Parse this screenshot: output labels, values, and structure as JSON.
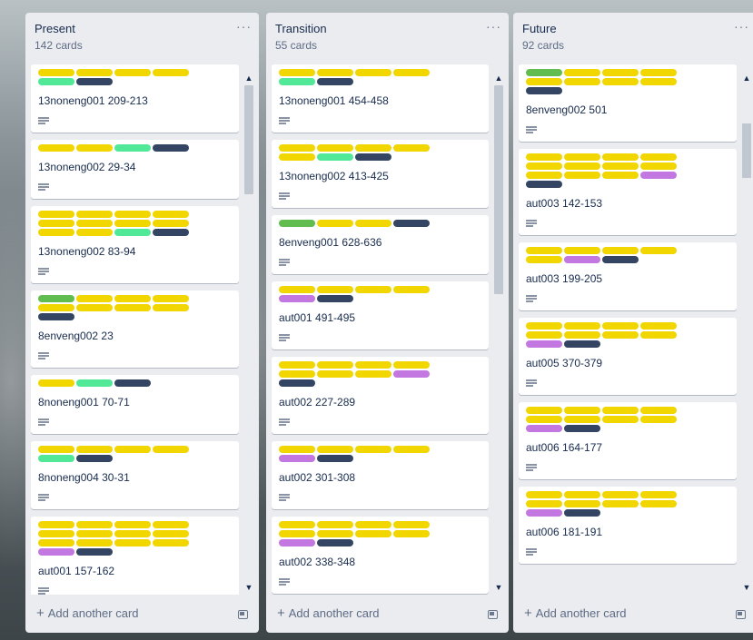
{
  "lists": [
    {
      "title": "Present",
      "count": "142 cards",
      "add_label": "Add another card",
      "cards": [
        {
          "labels": [
            "yellow",
            "yellow",
            "yellow",
            "yellow",
            "teal",
            "navy"
          ],
          "title": "13noneng001 209-213"
        },
        {
          "labels": [
            "yellow",
            "yellow",
            "teal",
            "navy"
          ],
          "title": "13noneng002 29-34"
        },
        {
          "labels": [
            "yellow",
            "yellow",
            "yellow",
            "yellow",
            "yellow",
            "yellow",
            "yellow",
            "yellow",
            "yellow",
            "yellow",
            "teal",
            "navy"
          ],
          "title": "13noneng002 83-94"
        },
        {
          "labels": [
            "green",
            "yellow",
            "yellow",
            "yellow",
            "yellow",
            "yellow",
            "yellow",
            "yellow",
            "navy"
          ],
          "title": "8enveng002 23"
        },
        {
          "labels": [
            "yellow",
            "teal",
            "navy"
          ],
          "title": "8noneng001 70-71"
        },
        {
          "labels": [
            "yellow",
            "yellow",
            "yellow",
            "yellow",
            "teal",
            "navy"
          ],
          "title": "8noneng004 30-31"
        },
        {
          "labels": [
            "yellow",
            "yellow",
            "yellow",
            "yellow",
            "yellow",
            "yellow",
            "yellow",
            "yellow",
            "yellow",
            "yellow",
            "yellow",
            "yellow",
            "purple",
            "navy"
          ],
          "title": "aut001 157-162"
        }
      ]
    },
    {
      "title": "Transition",
      "count": "55 cards",
      "add_label": "Add another card",
      "cards": [
        {
          "labels": [
            "yellow",
            "yellow",
            "yellow",
            "yellow",
            "teal",
            "navy"
          ],
          "title": "13noneng001 454-458"
        },
        {
          "labels": [
            "yellow",
            "yellow",
            "yellow",
            "yellow",
            "yellow",
            "teal",
            "navy"
          ],
          "title": "13noneng002 413-425"
        },
        {
          "labels": [
            "green",
            "yellow",
            "yellow",
            "navy"
          ],
          "title": "8enveng001 628-636"
        },
        {
          "labels": [
            "yellow",
            "yellow",
            "yellow",
            "yellow",
            "purple",
            "navy"
          ],
          "title": "aut001 491-495"
        },
        {
          "labels": [
            "yellow",
            "yellow",
            "yellow",
            "yellow",
            "yellow",
            "yellow",
            "yellow",
            "purple",
            "navy"
          ],
          "title": "aut002 227-289"
        },
        {
          "labels": [
            "yellow",
            "yellow",
            "yellow",
            "yellow",
            "purple",
            "navy"
          ],
          "title": "aut002 301-308"
        },
        {
          "labels": [
            "yellow",
            "yellow",
            "yellow",
            "yellow",
            "yellow",
            "yellow",
            "yellow",
            "yellow",
            "purple",
            "navy"
          ],
          "title": "aut002 338-348"
        }
      ]
    },
    {
      "title": "Future",
      "count": "92 cards",
      "add_label": "Add another card",
      "cards": [
        {
          "labels": [
            "green",
            "yellow",
            "yellow",
            "yellow",
            "yellow",
            "yellow",
            "yellow",
            "yellow",
            "navy"
          ],
          "title": "8enveng002 501"
        },
        {
          "labels": [
            "yellow",
            "yellow",
            "yellow",
            "yellow",
            "yellow",
            "yellow",
            "yellow",
            "yellow",
            "yellow",
            "yellow",
            "yellow",
            "purple",
            "navy"
          ],
          "title": "aut003 142-153"
        },
        {
          "labels": [
            "yellow",
            "yellow",
            "yellow",
            "yellow",
            "yellow",
            "purple",
            "navy"
          ],
          "title": "aut003 199-205"
        },
        {
          "labels": [
            "yellow",
            "yellow",
            "yellow",
            "yellow",
            "yellow",
            "yellow",
            "yellow",
            "yellow",
            "purple",
            "navy"
          ],
          "title": "aut005 370-379"
        },
        {
          "labels": [
            "yellow",
            "yellow",
            "yellow",
            "yellow",
            "yellow",
            "yellow",
            "yellow",
            "yellow",
            "purple",
            "navy"
          ],
          "title": "aut006 164-177"
        },
        {
          "labels": [
            "yellow",
            "yellow",
            "yellow",
            "yellow",
            "yellow",
            "yellow",
            "yellow",
            "yellow",
            "purple",
            "navy"
          ],
          "title": "aut006 181-191"
        }
      ]
    }
  ],
  "label_colors": {
    "yellow": "#f2d600",
    "green": "#61bd4f",
    "teal": "#51e898",
    "navy": "#344563",
    "purple": "#c377e0"
  }
}
